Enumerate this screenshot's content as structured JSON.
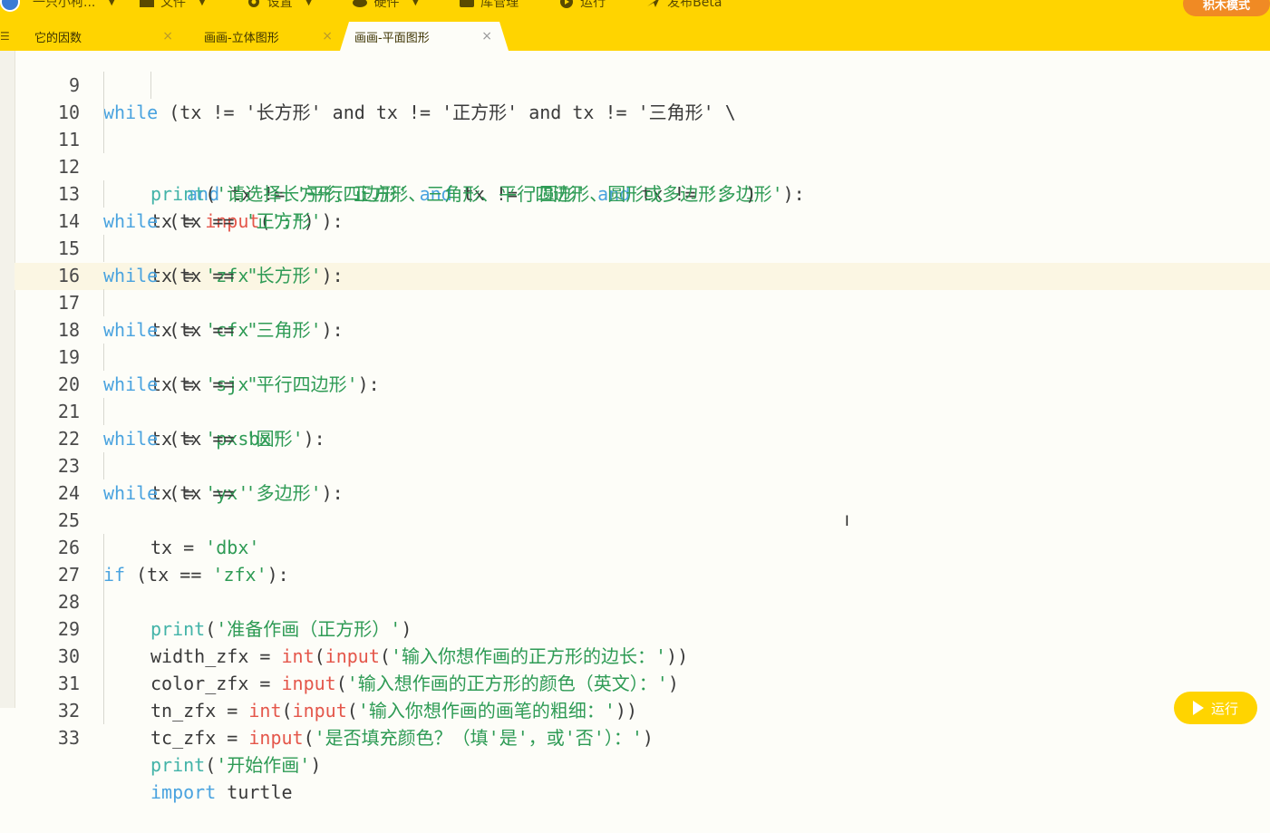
{
  "menu": {
    "app_name": "一只小柯...",
    "items": [
      {
        "label": "文件",
        "icon": "folder-icon"
      },
      {
        "label": "设置",
        "icon": "gear-icon"
      },
      {
        "label": "硬件",
        "icon": "hardware-icon"
      },
      {
        "label": "库管理",
        "icon": "library-icon"
      },
      {
        "label": "运行",
        "icon": "play-icon"
      },
      {
        "label": "发布Beta",
        "icon": "publish-icon"
      }
    ],
    "mode_button": "积木模式"
  },
  "tabs": [
    {
      "label": "它的因数",
      "active": false
    },
    {
      "label": "画画-立体图形",
      "active": false
    },
    {
      "label": "画画-平面图形",
      "active": true
    }
  ],
  "tab_close_glyph": "×",
  "editor": {
    "highlighted_line": "17",
    "lines": [
      {
        "n": "9"
      },
      {
        "n": "10"
      },
      {
        "n": "11"
      },
      {
        "n": "12"
      },
      {
        "n": "13"
      },
      {
        "n": "14"
      },
      {
        "n": "15"
      },
      {
        "n": "16"
      },
      {
        "n": "17"
      },
      {
        "n": "18"
      },
      {
        "n": "19"
      },
      {
        "n": "20"
      },
      {
        "n": "21"
      },
      {
        "n": "22"
      },
      {
        "n": "23"
      },
      {
        "n": "24"
      },
      {
        "n": "25"
      },
      {
        "n": "26"
      },
      {
        "n": "27"
      },
      {
        "n": "28"
      },
      {
        "n": "29"
      },
      {
        "n": "30"
      },
      {
        "n": "31"
      },
      {
        "n": "32"
      },
      {
        "n": "33"
      }
    ],
    "code": {
      "l9_kw": "while",
      "l9_rest": " (tx != '长方形' and tx != '正方形' and tx != '三角形' \\",
      "l10_and1": "and",
      "l10_a": " tx != ",
      "l10_s1": "'平行四边形'",
      "l10_and2": "and",
      "l10_b": " tx != ",
      "l10_s2": "'圆形'",
      "l10_and3": "and",
      "l10_c": " tx != ",
      "l10_s3": "'多边形'",
      "l10_end": "):",
      "l11_fn": "print",
      "l11_str": "'请选择长方形、正方形、三角形、平行四边形、圆形或多边形：'",
      "l12_a": "tx = ",
      "l12_fn": "input",
      "l12_str": "':'",
      "l13_kw": "while",
      "l13_a": " (tx == ",
      "l13_s": "'正方形'",
      "l14_a": "tx = ",
      "l14_s": "'zfx'",
      "l15_kw": "while",
      "l15_a": " (tx == ",
      "l15_s": "'长方形'",
      "l16_a": "tx = ",
      "l16_s": "'cfx'",
      "l17_kw": "while",
      "l17_a": " (tx == ",
      "l17_s": "'三角形'",
      "l18_a": "tx = ",
      "l18_s": "'sjx'",
      "l19_kw": "while",
      "l19_a": " (tx == ",
      "l19_s": "'平行四边形'",
      "l20_a": "tx = ",
      "l20_s": "'pxsbx'",
      "l21_kw": "while",
      "l21_a": " (tx == ",
      "l21_s": "'圆形'",
      "l22_a": "tx = ",
      "l22_s": "'yx'",
      "l23_kw": "while",
      "l23_a": " (tx == ",
      "l23_s": "'多边形'",
      "l24_a": "tx = ",
      "l24_s": "'dbx'",
      "l26_kw": "if",
      "l26_a": " (tx == ",
      "l26_s": "'zfx'",
      "l27_fn": "print",
      "l27_s": "'准备作画（正方形）'",
      "l28_a": "width_zfx = ",
      "l28_fn1": "int",
      "l28_fn2": "input",
      "l28_s": "'输入你想作画的正方形的边长：'",
      "l29_a": "color_zfx = ",
      "l29_fn": "input",
      "l29_s": "'输入想作画的正方形的颜色（英文）：'",
      "l30_a": "tn_zfx = ",
      "l30_fn1": "int",
      "l30_fn2": "input",
      "l30_s": "'输入你想作画的画笔的粗细：'",
      "l31_a": "tc_zfx = ",
      "l31_fn": "input",
      "l31_s": "'是否填充颜色？（填'是'，或'否'）：'",
      "l32_fn": "print",
      "l32_s": "'开始作画'",
      "l33_kw": "import",
      "l33_a": " turtle"
    },
    "close_paren_colon": "):",
    "lparen": "(",
    "rparen": ")",
    "rparen2": "))"
  },
  "run_button": "运行"
}
